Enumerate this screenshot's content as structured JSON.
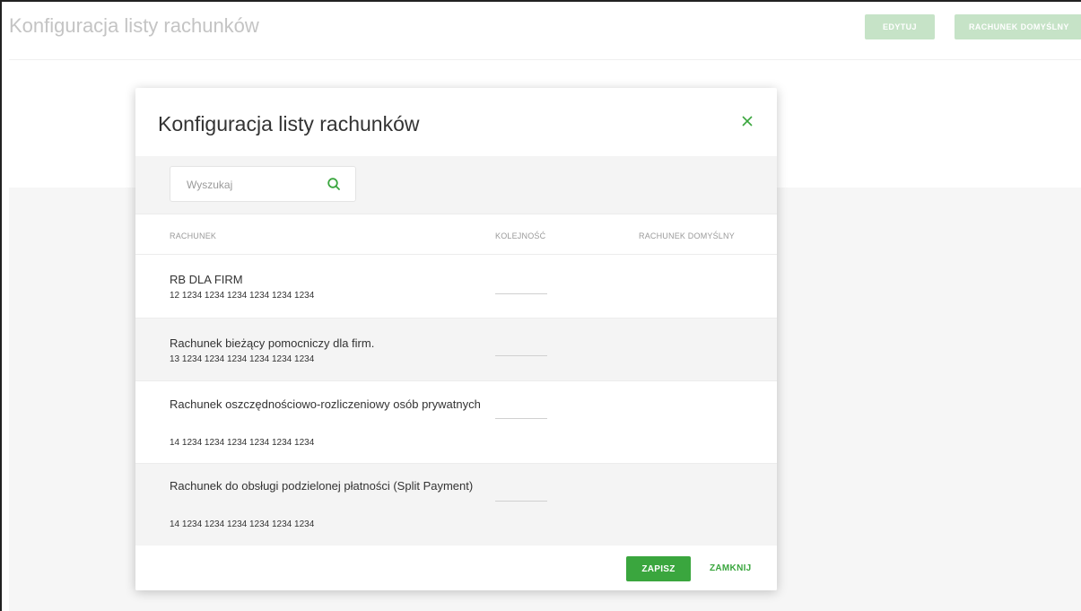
{
  "background": {
    "title": "Konfiguracja listy rachunków",
    "edit_button": "EDYTUJ",
    "default_account_button": "RACHUNEK DOMYŚLNY"
  },
  "modal": {
    "title": "Konfiguracja listy rachunków",
    "close_icon": "close-icon",
    "search": {
      "placeholder": "Wyszukaj",
      "value": "",
      "icon": "search-icon"
    },
    "columns": {
      "account": "RACHUNEK",
      "order": "KOLEJNOŚĆ",
      "default": "RACHUNEK DOMYŚLNY"
    },
    "accounts": [
      {
        "name": "RB DLA FIRM",
        "number": "12 1234 1234 1234 1234 1234 1234",
        "order": ""
      },
      {
        "name": "Rachunek bieżący pomocniczy dla firm.",
        "number": "13 1234 1234 1234 1234 1234 1234",
        "order": ""
      },
      {
        "name": "Rachunek oszczędnościowo-rozliczeniowy osób prywatnych",
        "number": "14 1234 1234 1234 1234 1234 1234",
        "order": ""
      },
      {
        "name": "Rachunek do obsługi podzielonej płatności (Split Payment)",
        "number": "14 1234 1234 1234 1234 1234 1234",
        "order": ""
      }
    ],
    "footer": {
      "save_label": "ZAPISZ",
      "close_label": "ZAMKNIJ"
    }
  },
  "colors": {
    "accent": "#3aa63e",
    "accent_faded": "#c6e3c7",
    "text": "#333333",
    "muted": "#9a9a9a"
  }
}
